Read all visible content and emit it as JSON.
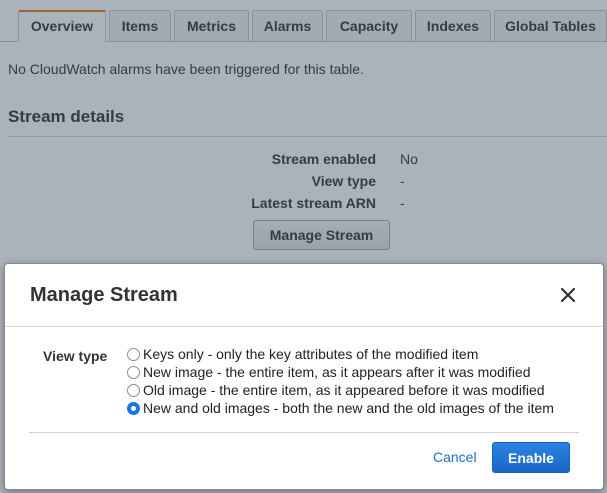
{
  "tabs": [
    {
      "label": "Overview",
      "active": true
    },
    {
      "label": "Items"
    },
    {
      "label": "Metrics"
    },
    {
      "label": "Alarms"
    },
    {
      "label": "Capacity"
    },
    {
      "label": "Indexes"
    },
    {
      "label": "Global Tables"
    }
  ],
  "overview": {
    "alarm_message": "No CloudWatch alarms have been triggered for this table.",
    "stream_section_title": "Stream details",
    "details": [
      {
        "label": "Stream enabled",
        "value": "No"
      },
      {
        "label": "View type",
        "value": "-"
      },
      {
        "label": "Latest stream ARN",
        "value": "-"
      }
    ],
    "manage_button": "Manage Stream"
  },
  "modal": {
    "title": "Manage Stream",
    "close_icon": "close-icon",
    "view_type_label": "View type",
    "options": [
      {
        "label": "Keys only - only the key attributes of the modified item",
        "selected": false
      },
      {
        "label": "New image - the entire item, as it appears after it was modified",
        "selected": false
      },
      {
        "label": "Old image - the entire item, as it appeared before it was modified",
        "selected": false
      },
      {
        "label": "New and old images - both the new and the old images of the item",
        "selected": true
      }
    ],
    "cancel_label": "Cancel",
    "enable_label": "Enable"
  },
  "colors": {
    "accent_tab": "#e07b10",
    "primary_button": "#1f73e8",
    "link": "#1a6fc9"
  }
}
